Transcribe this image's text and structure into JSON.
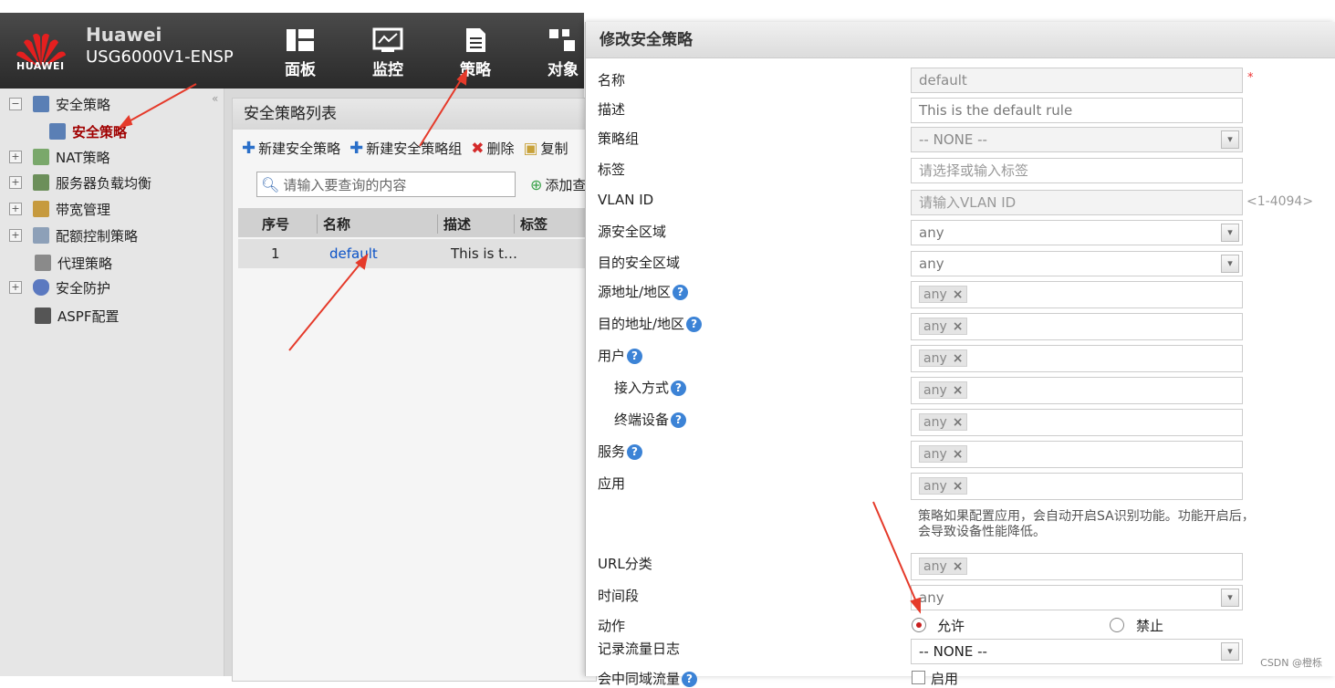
{
  "header": {
    "logo_text": "HUAWEI",
    "brand": "Huawei",
    "model": "USG6000V1-ENSP",
    "nav": [
      {
        "label": "面板",
        "icon": "dashboard-icon"
      },
      {
        "label": "监控",
        "icon": "monitor-icon"
      },
      {
        "label": "策略",
        "icon": "policy-document-icon"
      },
      {
        "label": "对象",
        "icon": "object-icon"
      }
    ]
  },
  "sidebar": {
    "items": [
      {
        "label": "安全策略",
        "expander": "−"
      },
      {
        "label": "安全策略",
        "selected": true
      },
      {
        "label": "NAT策略",
        "expander": "+"
      },
      {
        "label": "服务器负载均衡",
        "expander": "+"
      },
      {
        "label": "带宽管理",
        "expander": "+"
      },
      {
        "label": "配额控制策略",
        "expander": "+"
      },
      {
        "label": "代理策略"
      },
      {
        "label": "安全防护",
        "expander": "+"
      },
      {
        "label": "ASPF配置"
      }
    ]
  },
  "list_panel": {
    "title": "安全策略列表",
    "toolbar": {
      "new_policy": "新建安全策略",
      "new_group": "新建安全策略组",
      "delete": "删除",
      "copy": "复制"
    },
    "search_placeholder": "请输入要查询的内容",
    "add_query": "添加查",
    "columns": [
      "序号",
      "名称",
      "描述",
      "标签"
    ],
    "rows": [
      {
        "index": "1",
        "name": "default",
        "desc": "This is t…",
        "tag": ""
      }
    ]
  },
  "dialog": {
    "title": "修改安全策略",
    "fields": {
      "name_label": "名称",
      "name_value": "default",
      "required_mark": "*",
      "desc_label": "描述",
      "desc_value": "This is the default rule",
      "group_label": "策略组",
      "group_value": "-- NONE --",
      "tag_label": "标签",
      "tag_placeholder": "请选择或输入标签",
      "vlan_label": "VLAN ID",
      "vlan_placeholder": "请输入VLAN ID",
      "vlan_range": "<1-4094>",
      "src_zone_label": "源安全区域",
      "src_zone_value": "any",
      "dst_zone_label": "目的安全区域",
      "dst_zone_value": "any",
      "src_addr_label": "源地址/地区",
      "dst_addr_label": "目的地址/地区",
      "user_label": "用户",
      "access_label": "接入方式",
      "terminal_label": "终端设备",
      "service_label": "服务",
      "app_label": "应用",
      "app_note": "策略如果配置应用，会自动开启SA识别功能。功能开启后，会导致设备性能降低。",
      "url_label": "URL分类",
      "time_label": "时间段",
      "time_value": "any",
      "action_label": "动作",
      "action_allow": "允许",
      "action_deny": "禁止",
      "log_label": "记录流量日志",
      "log_value": "-- NONE --",
      "session_label": "会中同域流量",
      "session_enable": "启用",
      "tag_any": "any",
      "tag_remove": "×",
      "help_mark": "?"
    }
  },
  "watermark": "CSDN @橙栎"
}
